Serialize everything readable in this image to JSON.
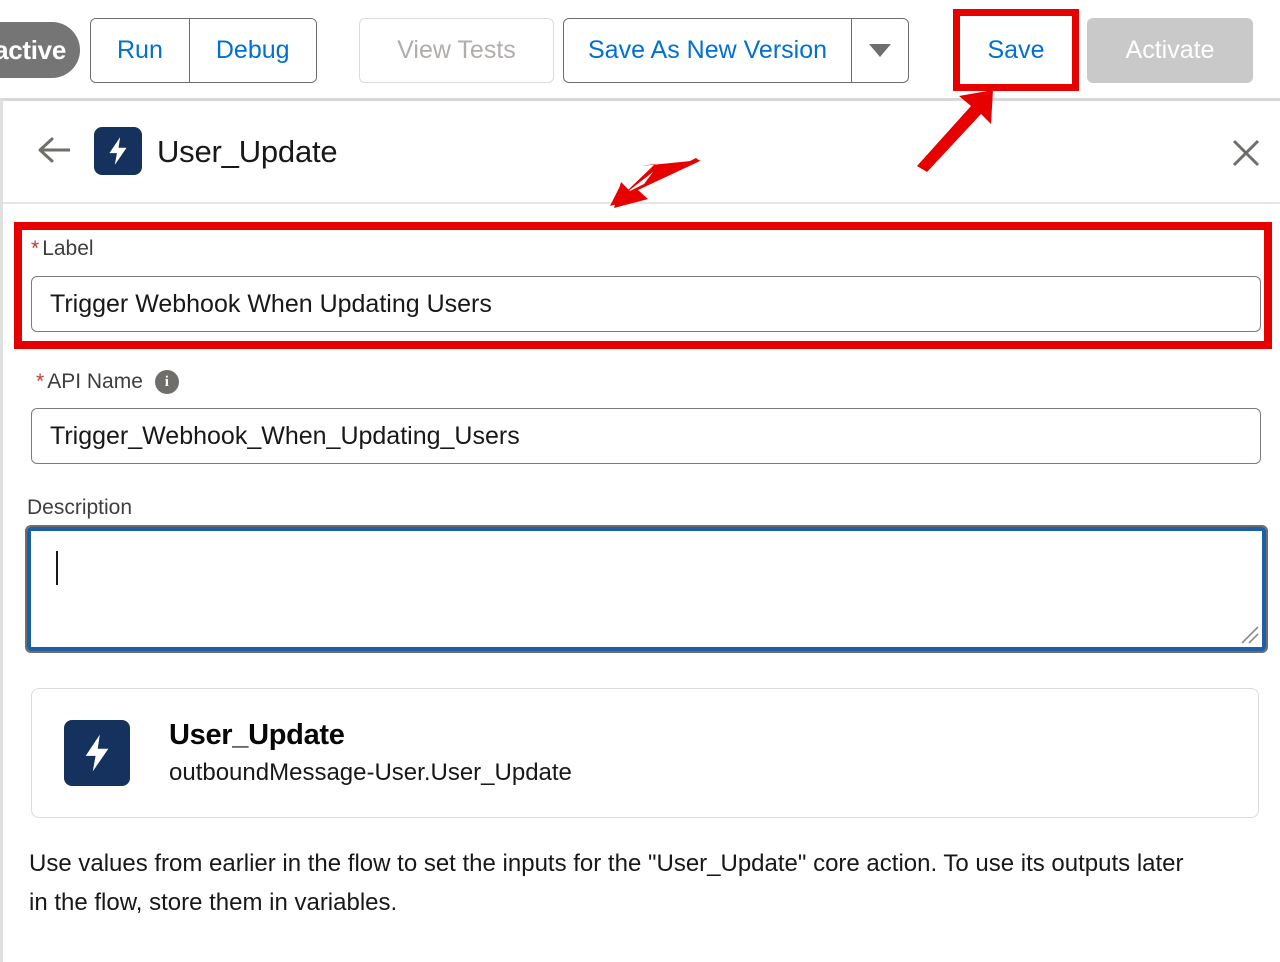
{
  "toolbar": {
    "status_badge": "Inactive",
    "run_label": "Run",
    "debug_label": "Debug",
    "view_tests_label": "View Tests",
    "save_as_new_version_label": "Save As New Version",
    "dropdown_icon": "chevron-down-icon",
    "save_label": "Save",
    "activate_label": "Activate"
  },
  "panel": {
    "back_icon": "back-arrow-icon",
    "app_icon": "lightning-bolt-icon",
    "title": "User_Update",
    "close_icon": "close-icon"
  },
  "form": {
    "required_marker": "*",
    "label_field": {
      "label": "Label",
      "value": "Trigger Webhook When Updating Users",
      "placeholder": ""
    },
    "api_name_field": {
      "label": "API Name",
      "info_icon": "info-icon",
      "info_glyph": "i",
      "value": "Trigger_Webhook_When_Updating_Users",
      "placeholder": ""
    },
    "description_field": {
      "label": "Description",
      "value": "",
      "placeholder": ""
    }
  },
  "action_card": {
    "icon": "lightning-bolt-icon",
    "title": "User_Update",
    "subtitle": "outboundMessage-User.User_Update"
  },
  "helper_text": "Use values from earlier in the flow to set the inputs for the \"User_Update\" core action. To use its outputs later in the flow, store them in variables.",
  "annotations": {
    "highlight_color": "#e60000",
    "arrow_to_label": "red-arrow-pointing-to-label-field",
    "arrow_to_save": "red-arrow-pointing-to-save-button",
    "box_around_label": "red-box-around-label-field",
    "box_around_save": "red-box-around-save-button"
  },
  "colors": {
    "link_blue": "#0070d2",
    "brand_navy": "#15325e",
    "disabled_gray": "#c9c9c9",
    "badge_gray": "#757575",
    "focus_blue": "#1b5fa8",
    "required_red": "#c23934"
  }
}
